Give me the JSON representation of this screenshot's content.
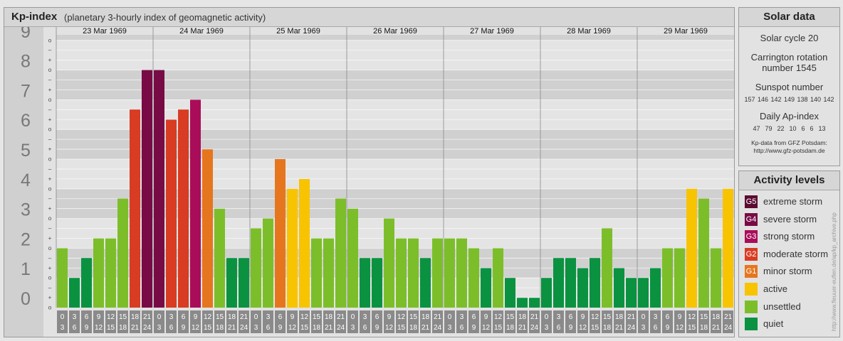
{
  "header": {
    "title": "Kp-index",
    "subtitle": "(planetary 3-hourly index of geomagnetic activity)"
  },
  "chart_data": {
    "type": "bar",
    "days": [
      "23 Mar 1969",
      "24 Mar 1969",
      "25 Mar 1969",
      "26 Mar 1969",
      "27 Mar 1969",
      "28 Mar 1969",
      "29 Mar 1969"
    ],
    "hour_starts": [
      "0",
      "3",
      "6",
      "9",
      "12",
      "15",
      "18",
      "21"
    ],
    "hour_ends": [
      "3",
      "6",
      "9",
      "12",
      "15",
      "18",
      "21",
      "24"
    ],
    "y_ticks": [
      "0",
      "1",
      "2",
      "3",
      "4",
      "5",
      "6",
      "7",
      "8",
      "9"
    ],
    "y_minor_labels": [
      "o",
      "+",
      "–"
    ],
    "ylim": [
      0,
      9.33
    ],
    "values": [
      2.0,
      1.0,
      1.67,
      2.33,
      2.33,
      3.67,
      6.67,
      8.0,
      8.0,
      6.33,
      6.67,
      7.0,
      5.33,
      3.33,
      1.67,
      1.67,
      2.67,
      3.0,
      5.0,
      4.0,
      4.33,
      2.33,
      2.33,
      3.67,
      3.33,
      1.67,
      1.67,
      3.0,
      2.33,
      2.33,
      1.67,
      2.33,
      2.33,
      2.33,
      2.0,
      1.33,
      2.0,
      1.0,
      0.33,
      0.33,
      1.0,
      1.67,
      1.67,
      1.33,
      1.67,
      2.67,
      1.33,
      1.0,
      1.0,
      1.33,
      2.0,
      2.0,
      4.0,
      3.67,
      2.0,
      4.0
    ],
    "levels": [
      {
        "key": "quiet",
        "max": 1.67,
        "color": "#0a9241"
      },
      {
        "key": "unsettled",
        "max": 3.67,
        "color": "#7cbe2a"
      },
      {
        "key": "active",
        "max": 4.67,
        "color": "#f8c300"
      },
      {
        "key": "G1",
        "max": 5.67,
        "color": "#e6761e"
      },
      {
        "key": "G2",
        "max": 6.67,
        "color": "#d83c23"
      },
      {
        "key": "G3",
        "max": 7.67,
        "color": "#a90d59"
      },
      {
        "key": "G4",
        "max": 8.67,
        "color": "#780b45"
      },
      {
        "key": "G5",
        "max": 9.33,
        "color": "#5c0a32"
      }
    ]
  },
  "solar_data": {
    "title": "Solar data",
    "solar_cycle": "Solar cycle 20",
    "carrington_line1": "Carrington rotation",
    "carrington_line2": "number 1545",
    "sunspot_label": "Sunspot number",
    "sunspot_values": "157 146 142 149 138 140 142",
    "ap_label": "Daily Ap-index",
    "ap_values": "47  79  22  10  6  6  13",
    "source_line1": "Kp-data from GFZ Potsdam:",
    "source_line2": "http://www.gfz-potsdam.de"
  },
  "legend": {
    "title": "Activity levels",
    "items": [
      {
        "code": "G5",
        "label": "extreme storm",
        "color": "#5c0a32"
      },
      {
        "code": "G4",
        "label": "severe storm",
        "color": "#780b45"
      },
      {
        "code": "G3",
        "label": "strong storm",
        "color": "#a90d59"
      },
      {
        "code": "G2",
        "label": "moderate storm",
        "color": "#d83c23"
      },
      {
        "code": "G1",
        "label": "minor storm",
        "color": "#e6761e"
      },
      {
        "code": "",
        "label": "active",
        "color": "#f8c300"
      },
      {
        "code": "",
        "label": "unsettled",
        "color": "#7cbe2a"
      },
      {
        "code": "",
        "label": "quiet",
        "color": "#0a9241"
      }
    ]
  },
  "credit": "http://www.fleuuer-euflen.de/ap/kp_archive.php"
}
